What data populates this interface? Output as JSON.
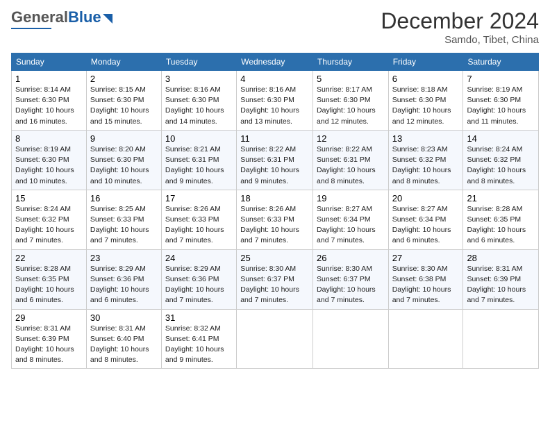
{
  "header": {
    "logo_general": "General",
    "logo_blue": "Blue",
    "month_title": "December 2024",
    "subtitle": "Samdo, Tibet, China"
  },
  "days_of_week": [
    "Sunday",
    "Monday",
    "Tuesday",
    "Wednesday",
    "Thursday",
    "Friday",
    "Saturday"
  ],
  "weeks": [
    [
      {
        "day": "1",
        "info": "Sunrise: 8:14 AM\nSunset: 6:30 PM\nDaylight: 10 hours\nand 16 minutes."
      },
      {
        "day": "2",
        "info": "Sunrise: 8:15 AM\nSunset: 6:30 PM\nDaylight: 10 hours\nand 15 minutes."
      },
      {
        "day": "3",
        "info": "Sunrise: 8:16 AM\nSunset: 6:30 PM\nDaylight: 10 hours\nand 14 minutes."
      },
      {
        "day": "4",
        "info": "Sunrise: 8:16 AM\nSunset: 6:30 PM\nDaylight: 10 hours\nand 13 minutes."
      },
      {
        "day": "5",
        "info": "Sunrise: 8:17 AM\nSunset: 6:30 PM\nDaylight: 10 hours\nand 12 minutes."
      },
      {
        "day": "6",
        "info": "Sunrise: 8:18 AM\nSunset: 6:30 PM\nDaylight: 10 hours\nand 12 minutes."
      },
      {
        "day": "7",
        "info": "Sunrise: 8:19 AM\nSunset: 6:30 PM\nDaylight: 10 hours\nand 11 minutes."
      }
    ],
    [
      {
        "day": "8",
        "info": "Sunrise: 8:19 AM\nSunset: 6:30 PM\nDaylight: 10 hours\nand 10 minutes."
      },
      {
        "day": "9",
        "info": "Sunrise: 8:20 AM\nSunset: 6:30 PM\nDaylight: 10 hours\nand 10 minutes."
      },
      {
        "day": "10",
        "info": "Sunrise: 8:21 AM\nSunset: 6:31 PM\nDaylight: 10 hours\nand 9 minutes."
      },
      {
        "day": "11",
        "info": "Sunrise: 8:22 AM\nSunset: 6:31 PM\nDaylight: 10 hours\nand 9 minutes."
      },
      {
        "day": "12",
        "info": "Sunrise: 8:22 AM\nSunset: 6:31 PM\nDaylight: 10 hours\nand 8 minutes."
      },
      {
        "day": "13",
        "info": "Sunrise: 8:23 AM\nSunset: 6:32 PM\nDaylight: 10 hours\nand 8 minutes."
      },
      {
        "day": "14",
        "info": "Sunrise: 8:24 AM\nSunset: 6:32 PM\nDaylight: 10 hours\nand 8 minutes."
      }
    ],
    [
      {
        "day": "15",
        "info": "Sunrise: 8:24 AM\nSunset: 6:32 PM\nDaylight: 10 hours\nand 7 minutes."
      },
      {
        "day": "16",
        "info": "Sunrise: 8:25 AM\nSunset: 6:33 PM\nDaylight: 10 hours\nand 7 minutes."
      },
      {
        "day": "17",
        "info": "Sunrise: 8:26 AM\nSunset: 6:33 PM\nDaylight: 10 hours\nand 7 minutes."
      },
      {
        "day": "18",
        "info": "Sunrise: 8:26 AM\nSunset: 6:33 PM\nDaylight: 10 hours\nand 7 minutes."
      },
      {
        "day": "19",
        "info": "Sunrise: 8:27 AM\nSunset: 6:34 PM\nDaylight: 10 hours\nand 7 minutes."
      },
      {
        "day": "20",
        "info": "Sunrise: 8:27 AM\nSunset: 6:34 PM\nDaylight: 10 hours\nand 6 minutes."
      },
      {
        "day": "21",
        "info": "Sunrise: 8:28 AM\nSunset: 6:35 PM\nDaylight: 10 hours\nand 6 minutes."
      }
    ],
    [
      {
        "day": "22",
        "info": "Sunrise: 8:28 AM\nSunset: 6:35 PM\nDaylight: 10 hours\nand 6 minutes."
      },
      {
        "day": "23",
        "info": "Sunrise: 8:29 AM\nSunset: 6:36 PM\nDaylight: 10 hours\nand 6 minutes."
      },
      {
        "day": "24",
        "info": "Sunrise: 8:29 AM\nSunset: 6:36 PM\nDaylight: 10 hours\nand 7 minutes."
      },
      {
        "day": "25",
        "info": "Sunrise: 8:30 AM\nSunset: 6:37 PM\nDaylight: 10 hours\nand 7 minutes."
      },
      {
        "day": "26",
        "info": "Sunrise: 8:30 AM\nSunset: 6:37 PM\nDaylight: 10 hours\nand 7 minutes."
      },
      {
        "day": "27",
        "info": "Sunrise: 8:30 AM\nSunset: 6:38 PM\nDaylight: 10 hours\nand 7 minutes."
      },
      {
        "day": "28",
        "info": "Sunrise: 8:31 AM\nSunset: 6:39 PM\nDaylight: 10 hours\nand 7 minutes."
      }
    ],
    [
      {
        "day": "29",
        "info": "Sunrise: 8:31 AM\nSunset: 6:39 PM\nDaylight: 10 hours\nand 8 minutes."
      },
      {
        "day": "30",
        "info": "Sunrise: 8:31 AM\nSunset: 6:40 PM\nDaylight: 10 hours\nand 8 minutes."
      },
      {
        "day": "31",
        "info": "Sunrise: 8:32 AM\nSunset: 6:41 PM\nDaylight: 10 hours\nand 9 minutes."
      },
      {
        "day": "",
        "info": ""
      },
      {
        "day": "",
        "info": ""
      },
      {
        "day": "",
        "info": ""
      },
      {
        "day": "",
        "info": ""
      }
    ]
  ]
}
